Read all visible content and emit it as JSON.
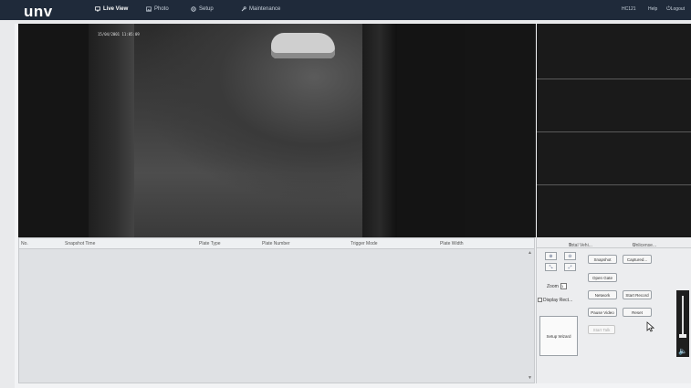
{
  "brand": {
    "logo": "unv"
  },
  "nav": [
    {
      "label": "Live View",
      "icon": "monitor-icon",
      "active": true
    },
    {
      "label": "Photo",
      "icon": "image-icon",
      "active": false
    },
    {
      "label": "Setup",
      "icon": "gear-icon",
      "active": false
    },
    {
      "label": "Maintenance",
      "icon": "wrench-icon",
      "active": false
    }
  ],
  "header_right": {
    "user": "HC121",
    "help": "Help",
    "logout": "Logout"
  },
  "video": {
    "timestamp": "15/04/2001 11:05:09"
  },
  "table": {
    "columns": [
      "No.",
      "Snapshot Time",
      "Plate Type",
      "Plate Number",
      "Trigger Mode",
      "Plate Width"
    ],
    "rows": []
  },
  "stats": {
    "total_label": "Total Vehi...",
    "total_value": "0",
    "unlicense_label": "Unlicense...",
    "unlicense_value": "0"
  },
  "controls": {
    "snapshot": "Snapshot",
    "captured": "Captured...",
    "open_gate": "Open Gate",
    "zoom_label": "Zoom",
    "zoom_value": "1",
    "display_rect": "Display Rect...",
    "network": "Network",
    "start_record": "Start Record",
    "pause_video": "Pause Video",
    "reset": "Reset",
    "start_talk": "Start Talk",
    "setup_wizard": "Setup Wizard"
  },
  "colors": {
    "topbar": "#1f2a3a",
    "accent_red": "#e03030"
  }
}
